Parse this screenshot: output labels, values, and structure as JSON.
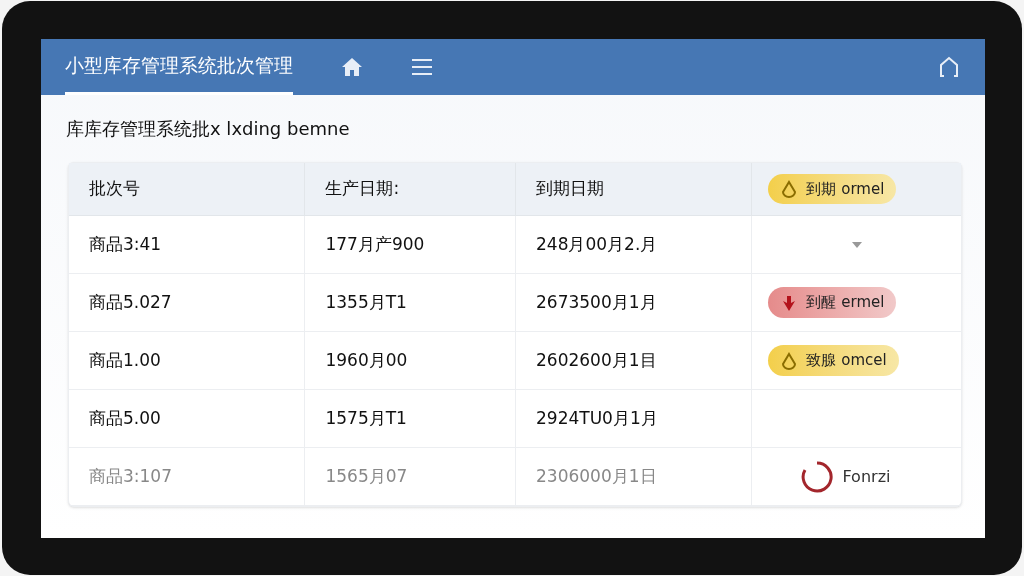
{
  "header": {
    "title": "小型库存管理系统批次管理",
    "selected": true
  },
  "subtitle": "库库存管理系统批x lxding bemne",
  "table": {
    "columns": [
      "批次号",
      "生产日期:",
      "到期日期"
    ],
    "header_badge": {
      "kind": "warning",
      "label": "到期 ormel"
    },
    "rows": [
      {
        "cells": [
          "商品3:41",
          "177月产900",
          "248月00月2.月"
        ],
        "status": {
          "kind": "caret"
        },
        "faded": false
      },
      {
        "cells": [
          "商品5.027",
          "1355月T1",
          "2673500月1月"
        ],
        "status": {
          "kind": "danger",
          "label": "到醒 ermel"
        },
        "faded": false
      },
      {
        "cells": [
          "商品1.00",
          "1960月00",
          "2602600月1目"
        ],
        "status": {
          "kind": "warning",
          "label": "致腺 omcel"
        },
        "faded": false
      },
      {
        "cells": [
          "商品5.00",
          "1575月T1",
          "2924TU0月1月"
        ],
        "status": {
          "kind": "none"
        },
        "faded": false
      },
      {
        "cells": [
          "商品3:107",
          "1565月07",
          "2306000月1日"
        ],
        "status": {
          "kind": "ring",
          "label": "Fonrzi"
        },
        "faded": true
      }
    ]
  }
}
